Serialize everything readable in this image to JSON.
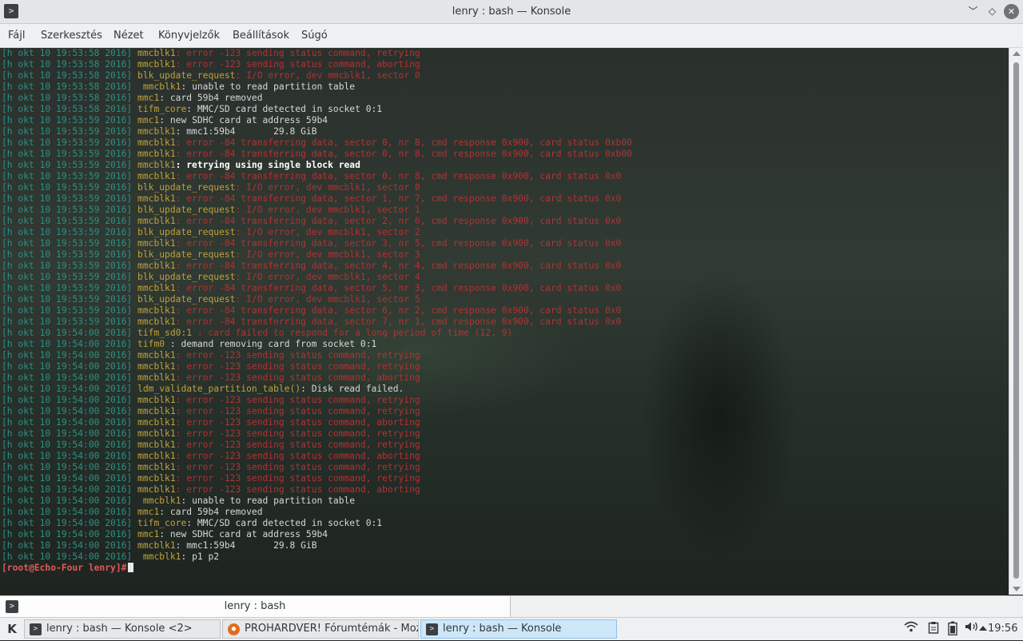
{
  "window": {
    "title": "lenry : bash — Konsole",
    "icon": "terminal-icon"
  },
  "menubar": {
    "items": [
      "Fájl",
      "Szerkesztés",
      "Nézet",
      "Könyvjelzők",
      "Beállítások",
      "Súgó"
    ]
  },
  "terminal": {
    "lines": [
      {
        "ts": "[h okt 10 19:53:58 2016]",
        "src": "mmcblk1",
        "msg": ": error -123 sending status command, retrying",
        "style": "err"
      },
      {
        "ts": "[h okt 10 19:53:58 2016]",
        "src": "mmcblk1",
        "msg": ": error -123 sending status command, aborting",
        "style": "err"
      },
      {
        "ts": "[h okt 10 19:53:58 2016]",
        "src": "blk_update_request",
        "msg": ": I/O error, dev mmcblk1, sector 0",
        "style": "err"
      },
      {
        "ts": "[h okt 10 19:53:58 2016]",
        "src": " mmcblk1",
        "msg": ": unable to read partition table",
        "style": "normal"
      },
      {
        "ts": "[h okt 10 19:53:58 2016]",
        "src": "mmc1",
        "msg": ": card 59b4 removed",
        "style": "normal"
      },
      {
        "ts": "[h okt 10 19:53:58 2016]",
        "src": "tifm_core",
        "msg": ": MMC/SD card detected in socket 0:1",
        "style": "normal"
      },
      {
        "ts": "[h okt 10 19:53:59 2016]",
        "src": "mmc1",
        "msg": ": new SDHC card at address 59b4",
        "style": "normal"
      },
      {
        "ts": "[h okt 10 19:53:59 2016]",
        "src": "mmcblk1",
        "msg": ": mmc1:59b4       29.8 GiB",
        "style": "normal"
      },
      {
        "ts": "[h okt 10 19:53:59 2016]",
        "src": "mmcblk1",
        "msg": ": error -84 transferring data, sector 0, nr 8, cmd response 0x900, card status 0xb00",
        "style": "err"
      },
      {
        "ts": "[h okt 10 19:53:59 2016]",
        "src": "mmcblk1",
        "msg": ": error -84 transferring data, sector 0, nr 8, cmd response 0x900, card status 0xb00",
        "style": "err"
      },
      {
        "ts": "[h okt 10 19:53:59 2016]",
        "src": "mmcblk1",
        "msg": ": retrying using single block read",
        "style": "bold"
      },
      {
        "ts": "[h okt 10 19:53:59 2016]",
        "src": "mmcblk1",
        "msg": ": error -84 transferring data, sector 0, nr 8, cmd response 0x900, card status 0x0",
        "style": "err"
      },
      {
        "ts": "[h okt 10 19:53:59 2016]",
        "src": "blk_update_request",
        "msg": ": I/O error, dev mmcblk1, sector 0",
        "style": "err"
      },
      {
        "ts": "[h okt 10 19:53:59 2016]",
        "src": "mmcblk1",
        "msg": ": error -84 transferring data, sector 1, nr 7, cmd response 0x900, card status 0x0",
        "style": "err"
      },
      {
        "ts": "[h okt 10 19:53:59 2016]",
        "src": "blk_update_request",
        "msg": ": I/O error, dev mmcblk1, sector 1",
        "style": "err"
      },
      {
        "ts": "[h okt 10 19:53:59 2016]",
        "src": "mmcblk1",
        "msg": ": error -84 transferring data, sector 2, nr 6, cmd response 0x900, card status 0x0",
        "style": "err"
      },
      {
        "ts": "[h okt 10 19:53:59 2016]",
        "src": "blk_update_request",
        "msg": ": I/O error, dev mmcblk1, sector 2",
        "style": "err"
      },
      {
        "ts": "[h okt 10 19:53:59 2016]",
        "src": "mmcblk1",
        "msg": ": error -84 transferring data, sector 3, nr 5, cmd response 0x900, card status 0x0",
        "style": "err"
      },
      {
        "ts": "[h okt 10 19:53:59 2016]",
        "src": "blk_update_request",
        "msg": ": I/O error, dev mmcblk1, sector 3",
        "style": "err"
      },
      {
        "ts": "[h okt 10 19:53:59 2016]",
        "src": "mmcblk1",
        "msg": ": error -84 transferring data, sector 4, nr 4, cmd response 0x900, card status 0x0",
        "style": "err"
      },
      {
        "ts": "[h okt 10 19:53:59 2016]",
        "src": "blk_update_request",
        "msg": ": I/O error, dev mmcblk1, sector 4",
        "style": "err"
      },
      {
        "ts": "[h okt 10 19:53:59 2016]",
        "src": "mmcblk1",
        "msg": ": error -84 transferring data, sector 5, nr 3, cmd response 0x900, card status 0x0",
        "style": "err"
      },
      {
        "ts": "[h okt 10 19:53:59 2016]",
        "src": "blk_update_request",
        "msg": ": I/O error, dev mmcblk1, sector 5",
        "style": "err"
      },
      {
        "ts": "[h okt 10 19:53:59 2016]",
        "src": "mmcblk1",
        "msg": ": error -84 transferring data, sector 6, nr 2, cmd response 0x900, card status 0x0",
        "style": "err"
      },
      {
        "ts": "[h okt 10 19:53:59 2016]",
        "src": "mmcblk1",
        "msg": ": error -84 transferring data, sector 7, nr 1, cmd response 0x900, card status 0x0",
        "style": "err"
      },
      {
        "ts": "[h okt 10 19:54:00 2016]",
        "src": "tifm_sd0:1",
        "msg": " : card failed to respond for a long period of time (12, 9)",
        "style": "err"
      },
      {
        "ts": "[h okt 10 19:54:00 2016]",
        "src": "tifm0",
        "msg": " : demand removing card from socket 0:1",
        "style": "normal"
      },
      {
        "ts": "[h okt 10 19:54:00 2016]",
        "src": "mmcblk1",
        "msg": ": error -123 sending status command, retrying",
        "style": "err"
      },
      {
        "ts": "[h okt 10 19:54:00 2016]",
        "src": "mmcblk1",
        "msg": ": error -123 sending status command, retrying",
        "style": "err"
      },
      {
        "ts": "[h okt 10 19:54:00 2016]",
        "src": "mmcblk1",
        "msg": ": error -123 sending status command, aborting",
        "style": "err"
      },
      {
        "ts": "[h okt 10 19:54:00 2016]",
        "src": "ldm_validate_partition_table()",
        "msg": ": Disk read failed.",
        "style": "normal"
      },
      {
        "ts": "[h okt 10 19:54:00 2016]",
        "src": "mmcblk1",
        "msg": ": error -123 sending status command, retrying",
        "style": "err"
      },
      {
        "ts": "[h okt 10 19:54:00 2016]",
        "src": "mmcblk1",
        "msg": ": error -123 sending status command, retrying",
        "style": "err"
      },
      {
        "ts": "[h okt 10 19:54:00 2016]",
        "src": "mmcblk1",
        "msg": ": error -123 sending status command, aborting",
        "style": "err"
      },
      {
        "ts": "[h okt 10 19:54:00 2016]",
        "src": "mmcblk1",
        "msg": ": error -123 sending status command, retrying",
        "style": "err"
      },
      {
        "ts": "[h okt 10 19:54:00 2016]",
        "src": "mmcblk1",
        "msg": ": error -123 sending status command, retrying",
        "style": "err"
      },
      {
        "ts": "[h okt 10 19:54:00 2016]",
        "src": "mmcblk1",
        "msg": ": error -123 sending status command, aborting",
        "style": "err"
      },
      {
        "ts": "[h okt 10 19:54:00 2016]",
        "src": "mmcblk1",
        "msg": ": error -123 sending status command, retrying",
        "style": "err"
      },
      {
        "ts": "[h okt 10 19:54:00 2016]",
        "src": "mmcblk1",
        "msg": ": error -123 sending status command, retrying",
        "style": "err"
      },
      {
        "ts": "[h okt 10 19:54:00 2016]",
        "src": "mmcblk1",
        "msg": ": error -123 sending status command, aborting",
        "style": "err"
      },
      {
        "ts": "[h okt 10 19:54:00 2016]",
        "src": " mmcblk1",
        "msg": ": unable to read partition table",
        "style": "normal"
      },
      {
        "ts": "[h okt 10 19:54:00 2016]",
        "src": "mmc1",
        "msg": ": card 59b4 removed",
        "style": "normal"
      },
      {
        "ts": "[h okt 10 19:54:00 2016]",
        "src": "tifm_core",
        "msg": ": MMC/SD card detected in socket 0:1",
        "style": "normal"
      },
      {
        "ts": "[h okt 10 19:54:00 2016]",
        "src": "mmc1",
        "msg": ": new SDHC card at address 59b4",
        "style": "normal"
      },
      {
        "ts": "[h okt 10 19:54:00 2016]",
        "src": "mmcblk1",
        "msg": ": mmc1:59b4       29.8 GiB",
        "style": "normal"
      },
      {
        "ts": "[h okt 10 19:54:00 2016]",
        "src": " mmcblk1",
        "msg": ": p1 p2",
        "style": "normal"
      }
    ],
    "prompt": "[root@Echo-Four lenry]#"
  },
  "tabs": [
    {
      "label": "lenry : bash",
      "icon": "terminal-icon"
    }
  ],
  "taskbar": {
    "launcher_icon": "kde-launcher-icon",
    "tasks": [
      {
        "label": "lenry : bash — Konsole <2>",
        "icon": "terminal-icon",
        "active": false
      },
      {
        "label": "PROHARDVER! Fórumtémák - Moz...",
        "icon": "firefox-icon",
        "active": false
      },
      {
        "label": "lenry : bash — Konsole",
        "icon": "terminal-icon",
        "active": true
      }
    ],
    "tray_icons": [
      "wifi-icon",
      "clipboard-icon",
      "battery-icon",
      "volume-icon",
      "expand-tray-icon"
    ],
    "clock": "19:56"
  },
  "colors": {
    "timestamp": "#2c8f84",
    "source": "#c1a13a",
    "error": "#b33232",
    "prompt": "#e3585a",
    "active_task": "#cde6f8"
  }
}
